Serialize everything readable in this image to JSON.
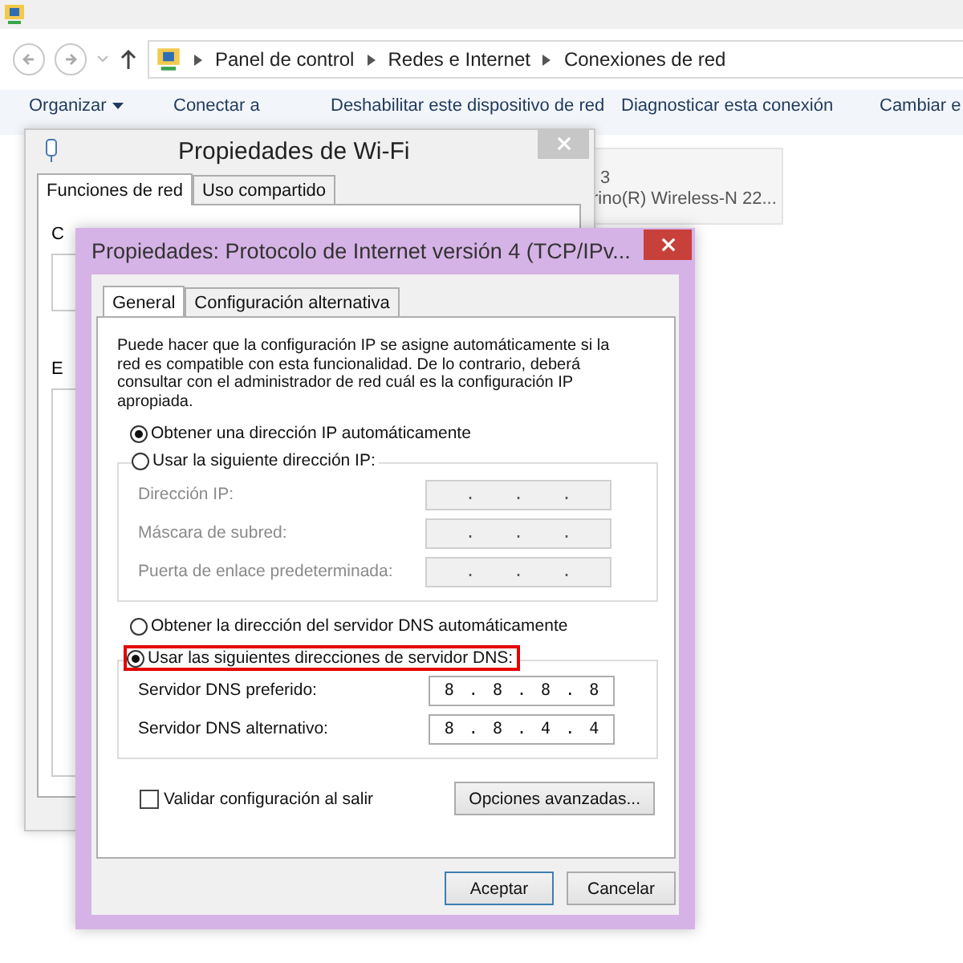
{
  "explorer": {
    "breadcrumb": [
      "Panel de control",
      "Redes e Internet",
      "Conexiones de red"
    ],
    "toolbar": [
      "Organizar",
      "Conectar a",
      "Deshabilitar este dispositivo de red",
      "Diagnosticar esta conexión",
      "Cambiar e"
    ],
    "connection": {
      "name": "3",
      "adapter": "rino(R) Wireless-N 22..."
    }
  },
  "wifi_window": {
    "title": "Propiedades de Wi-Fi",
    "tabs": [
      {
        "label": "Funciones de red",
        "selected": true
      },
      {
        "label": "Uso compartido",
        "selected": false
      }
    ],
    "labels": [
      "C",
      "E"
    ]
  },
  "tcp_window": {
    "title": "Propiedades: Protocolo de Internet versión 4 (TCP/IPv...",
    "tabs": [
      {
        "label": "General",
        "selected": true
      },
      {
        "label": "Configuración alternativa",
        "selected": false
      }
    ],
    "description": "Puede hacer que la configuración IP se asigne automáticamente si la red es compatible con esta funcionalidad. De lo contrario, deberá consultar con el administrador de red cuál es la configuración IP apropiada.",
    "ip_auto": {
      "label": "Obtener una dirección IP automáticamente",
      "selected": true
    },
    "ip_manual": {
      "label": "Usar la siguiente dirección IP:",
      "selected": false,
      "highlighted": false,
      "fields": [
        {
          "label": "Dirección IP:",
          "value": ". . .",
          "disabled": true
        },
        {
          "label": "Máscara de subred:",
          "value": ". . .",
          "disabled": true
        },
        {
          "label": "Puerta de enlace predeterminada:",
          "value": ". . .",
          "disabled": true
        }
      ]
    },
    "dns_auto": {
      "label": "Obtener la dirección del servidor DNS automáticamente",
      "selected": false
    },
    "dns_manual": {
      "label": "Usar las siguientes direcciones de servidor DNS:",
      "selected": true,
      "highlighted": true,
      "fields": [
        {
          "label": "Servidor DNS preferido:",
          "value": "8 . 8 . 8 . 8",
          "disabled": false
        },
        {
          "label": "Servidor DNS alternativo:",
          "value": "8 . 8 . 4 . 4",
          "disabled": false
        }
      ]
    },
    "validate": {
      "label": "Validar configuración al salir",
      "checked": false
    },
    "advanced_button": "Opciones avanzadas...",
    "buttons": [
      "Aceptar",
      "Cancelar"
    ]
  }
}
